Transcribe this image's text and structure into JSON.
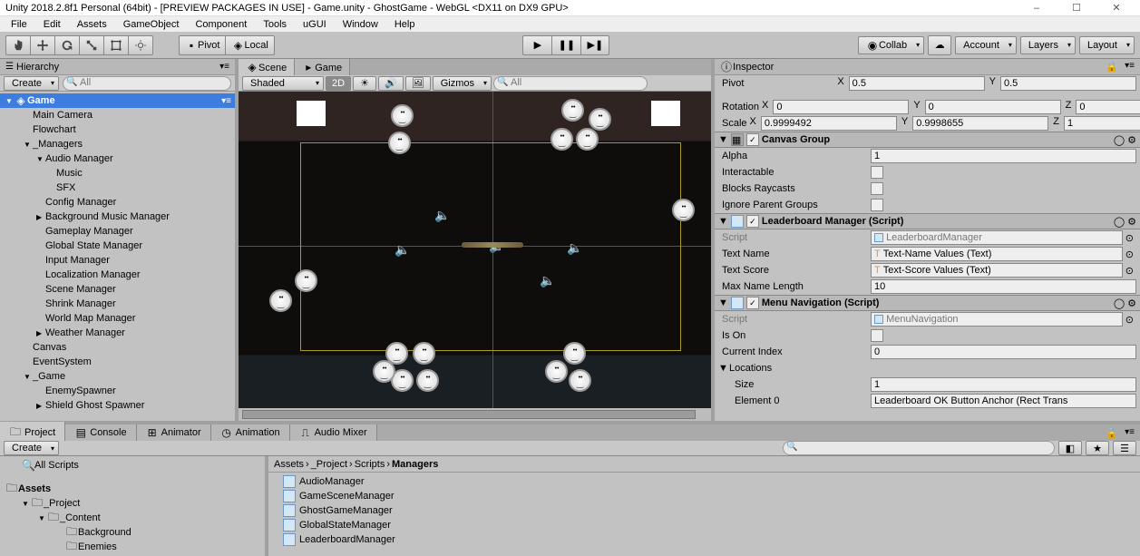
{
  "title": "Unity 2018.2.8f1 Personal (64bit) - [PREVIEW PACKAGES IN USE] - Game.unity - GhostGame - WebGL <DX11 on DX9 GPU>",
  "menu": [
    "File",
    "Edit",
    "Assets",
    "GameObject",
    "Component",
    "Tools",
    "uGUI",
    "Window",
    "Help"
  ],
  "toolbar": {
    "pivot": "Pivot",
    "local": "Local",
    "collab": "Collab",
    "account": "Account",
    "layers": "Layers",
    "layout": "Layout"
  },
  "hierarchy": {
    "title": "Hierarchy",
    "create": "Create",
    "search_ph": "All",
    "root": "Game",
    "items": [
      {
        "label": "Main Camera",
        "indent": 36
      },
      {
        "label": "Flowchart",
        "indent": 36
      },
      {
        "label": "_Managers",
        "indent": 26,
        "tw": "▼"
      },
      {
        "label": "Audio Manager",
        "indent": 40,
        "tw": "▼"
      },
      {
        "label": "Music",
        "indent": 62
      },
      {
        "label": "SFX",
        "indent": 62
      },
      {
        "label": "Config Manager",
        "indent": 50
      },
      {
        "label": "Background Music Manager",
        "indent": 40,
        "tw": "▶"
      },
      {
        "label": "Gameplay Manager",
        "indent": 50
      },
      {
        "label": "Global State Manager",
        "indent": 50
      },
      {
        "label": "Input Manager",
        "indent": 50
      },
      {
        "label": "Localization Manager",
        "indent": 50
      },
      {
        "label": "Scene Manager",
        "indent": 50
      },
      {
        "label": "Shrink Manager",
        "indent": 50
      },
      {
        "label": "World Map Manager",
        "indent": 50
      },
      {
        "label": "Weather Manager",
        "indent": 40,
        "tw": "▶"
      },
      {
        "label": "Canvas",
        "indent": 36
      },
      {
        "label": "EventSystem",
        "indent": 36
      },
      {
        "label": "_Game",
        "indent": 26,
        "tw": "▼"
      },
      {
        "label": "EnemySpawner",
        "indent": 50
      },
      {
        "label": "Shield Ghost Spawner",
        "indent": 40,
        "tw": "▶"
      }
    ]
  },
  "scene": {
    "tabs": [
      "Scene",
      "Game"
    ],
    "shaded": "Shaded",
    "twod": "2D",
    "gizmos": "Gizmos",
    "search_ph": "All"
  },
  "inspector": {
    "title": "Inspector",
    "pivot": {
      "label": "Pivot",
      "x": "0.5",
      "y": "0.5"
    },
    "rotation": {
      "label": "Rotation",
      "x": "0",
      "y": "0",
      "z": "0"
    },
    "scale": {
      "label": "Scale",
      "x": "0.9999492",
      "y": "0.9998655",
      "z": "1"
    },
    "canvasgroup": {
      "title": "Canvas Group",
      "alpha": {
        "label": "Alpha",
        "val": "1"
      },
      "interactable": {
        "label": "Interactable"
      },
      "blocks": {
        "label": "Blocks Raycasts"
      },
      "ignore": {
        "label": "Ignore Parent Groups"
      }
    },
    "leaderboard": {
      "title": "Leaderboard Manager (Script)",
      "script": {
        "label": "Script",
        "val": "LeaderboardManager"
      },
      "textname": {
        "label": "Text Name",
        "val": "Text-Name Values (Text)"
      },
      "textscore": {
        "label": "Text Score",
        "val": "Text-Score Values (Text)"
      },
      "maxname": {
        "label": "Max Name Length",
        "val": "10"
      }
    },
    "menunav": {
      "title": "Menu Navigation (Script)",
      "script": {
        "label": "Script",
        "val": "MenuNavigation"
      },
      "ison": {
        "label": "Is On"
      },
      "curidx": {
        "label": "Current Index",
        "val": "0"
      },
      "locations": {
        "label": "Locations"
      },
      "size": {
        "label": "Size",
        "val": "1"
      },
      "el0": {
        "label": "Element 0",
        "val": "Leaderboard OK Button Anchor (Rect Trans"
      }
    }
  },
  "project": {
    "tabs": [
      "Project",
      "Console",
      "Animator",
      "Animation",
      "Audio Mixer"
    ],
    "create": "Create",
    "search_ph": "",
    "allscripts": "All Scripts",
    "assets_hdr": "Assets",
    "tree": [
      {
        "label": "_Project",
        "indent": 24,
        "tw": "▼"
      },
      {
        "label": "_Content",
        "indent": 42,
        "tw": "▼"
      },
      {
        "label": "Background",
        "indent": 62
      },
      {
        "label": "Enemies",
        "indent": 62
      }
    ],
    "breadcrumb": [
      "Assets",
      "_Project",
      "Scripts",
      "Managers"
    ],
    "files": [
      "AudioManager",
      "GameSceneManager",
      "GhostGameManager",
      "GlobalStateManager",
      "LeaderboardManager"
    ]
  }
}
